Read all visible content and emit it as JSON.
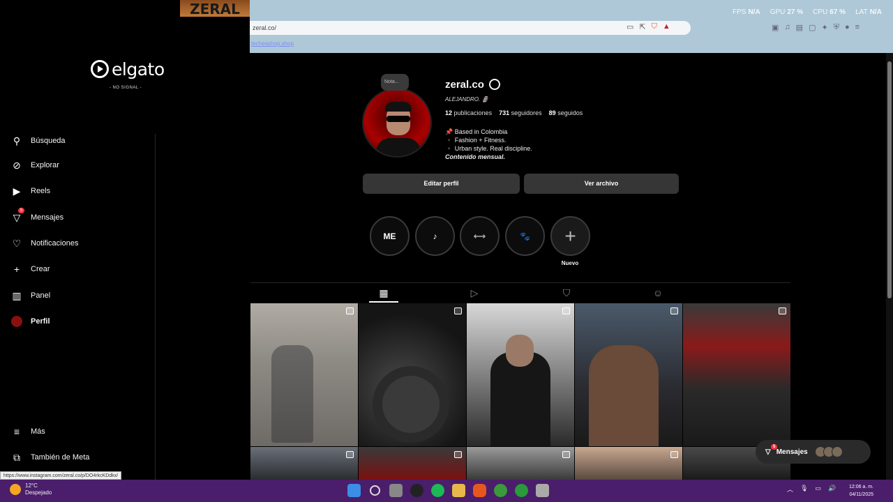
{
  "overlay": {
    "brand": "elgato",
    "no_signal": "- NO SIGNAL -",
    "banner": "ZERAL"
  },
  "browser": {
    "url": "zeral.co/",
    "bookmark": "techeashop.shop",
    "perf": [
      {
        "label": "FPS",
        "value": "N/A"
      },
      {
        "label": "GPU",
        "value": "27 %"
      },
      {
        "label": "CPU",
        "value": "67 %"
      },
      {
        "label": "LAT",
        "value": "N/A"
      }
    ]
  },
  "nav": {
    "items": [
      {
        "label": "Búsqueda",
        "icon": "search-icon"
      },
      {
        "label": "Explorar",
        "icon": "compass-icon"
      },
      {
        "label": "Reels",
        "icon": "reels-icon"
      },
      {
        "label": "Mensajes",
        "icon": "messenger-icon",
        "badge": "5"
      },
      {
        "label": "Notificaciones",
        "icon": "heart-icon"
      },
      {
        "label": "Crear",
        "icon": "plus-icon"
      },
      {
        "label": "Panel",
        "icon": "chart-icon"
      },
      {
        "label": "Perfil",
        "icon": "avatar-icon"
      }
    ],
    "more": "Más",
    "meta": "También de Meta"
  },
  "profile": {
    "note": "Nota...",
    "username": "zeral.co",
    "fullname": "ALEJANDRO. 🗿",
    "stats": {
      "posts": "12",
      "posts_label": "publicaciones",
      "followers": "731",
      "followers_label": "seguidores",
      "following": "89",
      "following_label": "seguidos"
    },
    "bio": [
      "📌 Based in Colombia",
      "▪️ Fashion + Fitness.",
      "▪️ Urban style. Real discipline."
    ],
    "bio_emphasis": "Contenido mensual.",
    "edit_button": "Editar perfil",
    "archive_button": "Ver archivo"
  },
  "highlights": [
    {
      "label": "ME"
    },
    {
      "label": "♪"
    },
    {
      "label": "⟷"
    },
    {
      "label": "🐾"
    },
    {
      "label": "+"
    }
  ],
  "new_label": "Nuevo",
  "messages": {
    "label": "Mensajes",
    "badge": "5"
  },
  "status_url": "https://www.instagram.com/zeral.co/p/DO4rkcKDdkx/",
  "taskbar": {
    "temp": "12°C",
    "weather": "Despejado",
    "time": "12:06 a. m.",
    "date": "04/11/2025"
  },
  "colors": {
    "taskbar": "#4a1e6a",
    "browser_top": "#aec8d8",
    "badge": "#ff3040"
  }
}
